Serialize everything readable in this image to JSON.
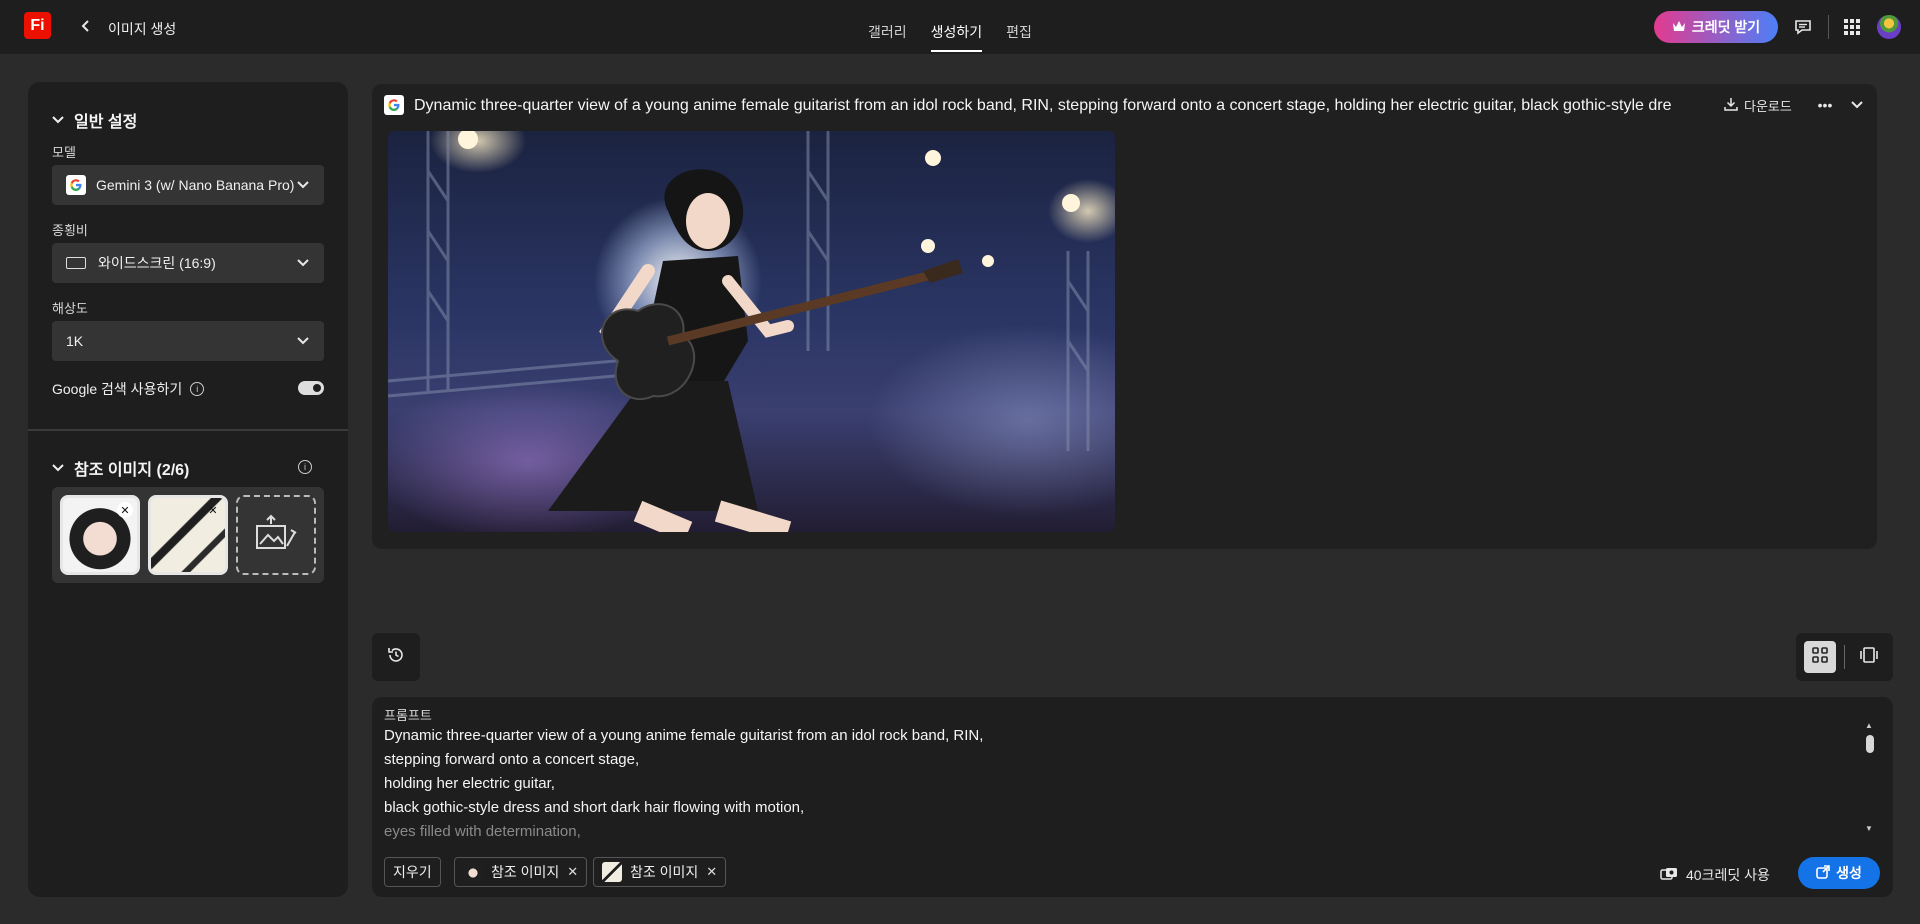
{
  "app": {
    "logo_text": "Fi",
    "title": "이미지 생성"
  },
  "nav": {
    "tabs": [
      "갤러리",
      "생성하기",
      "편집"
    ],
    "active_index": 1
  },
  "header": {
    "credit_button": "크레딧 받기"
  },
  "settings": {
    "section_title": "일반 설정",
    "model": {
      "label": "모델",
      "value": "Gemini 3 (w/ Nano Banana Pro)"
    },
    "aspect": {
      "label": "종횡비",
      "value": "와이드스크린 (16:9)"
    },
    "resolution": {
      "label": "해상도",
      "value": "1K"
    },
    "google_search": {
      "label": "Google 검색 사용하기",
      "enabled": true
    }
  },
  "references": {
    "section_title": "참조 이미지 (2/6)",
    "count": 2,
    "max": 6
  },
  "result": {
    "prompt_title": "Dynamic three-quarter view of a young anime female guitarist from an idol rock band, RIN, stepping forward onto a concert stage, holding her electric guitar, black gothic-style dre",
    "download_label": "다운로드"
  },
  "prompt": {
    "label": "프롬프트",
    "lines": [
      "Dynamic three-quarter view of a young anime female guitarist from an idol rock band, RIN,",
      "stepping forward onto a concert stage,",
      "holding her electric guitar,",
      "black gothic-style dress and short dark hair flowing with motion,",
      "eyes filled with determination,"
    ],
    "clear_label": "지우기",
    "chips": [
      "참조 이미지",
      "참조 이미지"
    ],
    "credits_text": "40크레딧 사용",
    "generate_label": "생성"
  },
  "colors": {
    "accent_blue": "#1473e6",
    "brand_red": "#eb1000",
    "panel": "#1e1e1e",
    "background": "#2b2b2b"
  }
}
